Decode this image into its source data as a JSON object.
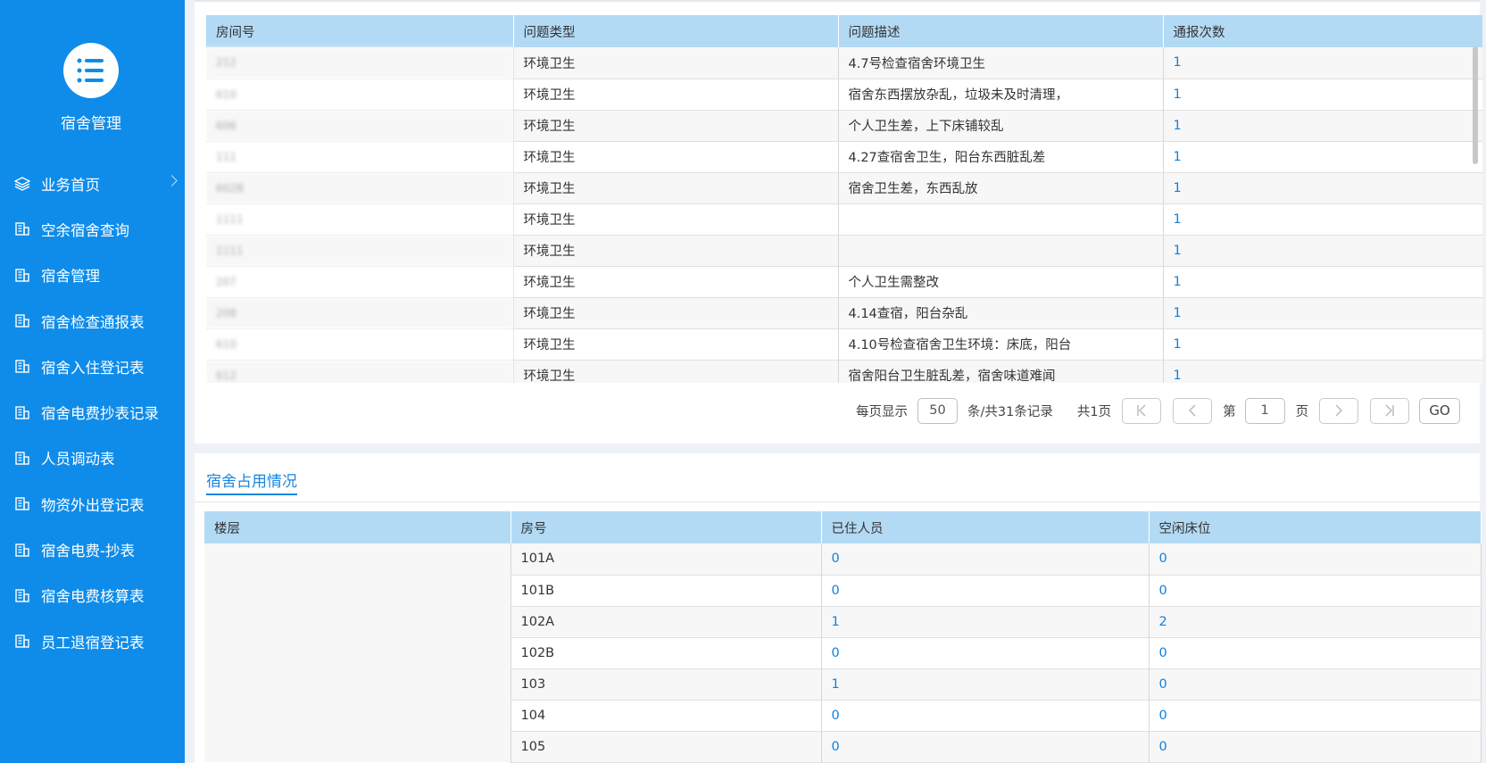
{
  "sidebar": {
    "title": "宿舍管理",
    "items": [
      {
        "label": "业务首页",
        "icon": "layers-icon"
      },
      {
        "label": "空余宿舍查询",
        "icon": "building-icon"
      },
      {
        "label": "宿舍管理",
        "icon": "building-icon"
      },
      {
        "label": "宿舍检查通报表",
        "icon": "building-icon"
      },
      {
        "label": "宿舍入住登记表",
        "icon": "building-icon"
      },
      {
        "label": "宿舍电费抄表记录",
        "icon": "building-icon"
      },
      {
        "label": "人员调动表",
        "icon": "building-icon"
      },
      {
        "label": "物资外出登记表",
        "icon": "building-icon"
      },
      {
        "label": "宿舍电费-抄表",
        "icon": "building-icon"
      },
      {
        "label": "宿舍电费核算表",
        "icon": "building-icon"
      },
      {
        "label": "员工退宿登记表",
        "icon": "building-icon"
      }
    ]
  },
  "inspection": {
    "headers": [
      "房间号",
      "问题类型",
      "问题描述",
      "通报次数"
    ],
    "rows": [
      [
        "212",
        "环境卫生",
        "4.7号检查宿舍环境卫生",
        "1"
      ],
      [
        "610",
        "环境卫生",
        "宿舍东西摆放杂乱，垃圾未及时清理，",
        "1"
      ],
      [
        "606",
        "环境卫生",
        "个人卫生差，上下床铺较乱",
        "1"
      ],
      [
        "111",
        "环境卫生",
        "4.27查宿舍卫生，阳台东西脏乱差",
        "1"
      ],
      [
        "602B",
        "环境卫生",
        "宿舍卫生差，东西乱放",
        "1"
      ],
      [
        "1111",
        "环境卫生",
        "",
        "1"
      ],
      [
        "1111",
        "环境卫生",
        "",
        "1"
      ],
      [
        "207",
        "环境卫生",
        "个人卫生需整改",
        "1"
      ],
      [
        "208",
        "环境卫生",
        "4.14查宿，阳台杂乱",
        "1"
      ],
      [
        "610",
        "环境卫生",
        "4.10号检查宿舍卫生环境：床底，阳台",
        "1"
      ],
      [
        "612",
        "环境卫生",
        "宿舍阳台卫生脏乱差，宿舍味道难闻",
        "1"
      ]
    ],
    "pager": {
      "per_page_label": "每页显示",
      "per_page_value": "50",
      "records_label": "条/共31条记录",
      "total_pages_label": "共1页",
      "page_prefix": "第",
      "page_value": "1",
      "page_suffix": "页",
      "go_label": "GO"
    }
  },
  "occupancy": {
    "title": "宿舍占用情况",
    "headers": [
      "楼层",
      "房号",
      "已住人员",
      "空闲床位"
    ],
    "rows": [
      [
        "101A",
        "0",
        "0"
      ],
      [
        "101B",
        "0",
        "0"
      ],
      [
        "102A",
        "1",
        "2"
      ],
      [
        "102B",
        "0",
        "0"
      ],
      [
        "103",
        "1",
        "0"
      ],
      [
        "104",
        "0",
        "0"
      ],
      [
        "105",
        "0",
        "0"
      ]
    ]
  }
}
